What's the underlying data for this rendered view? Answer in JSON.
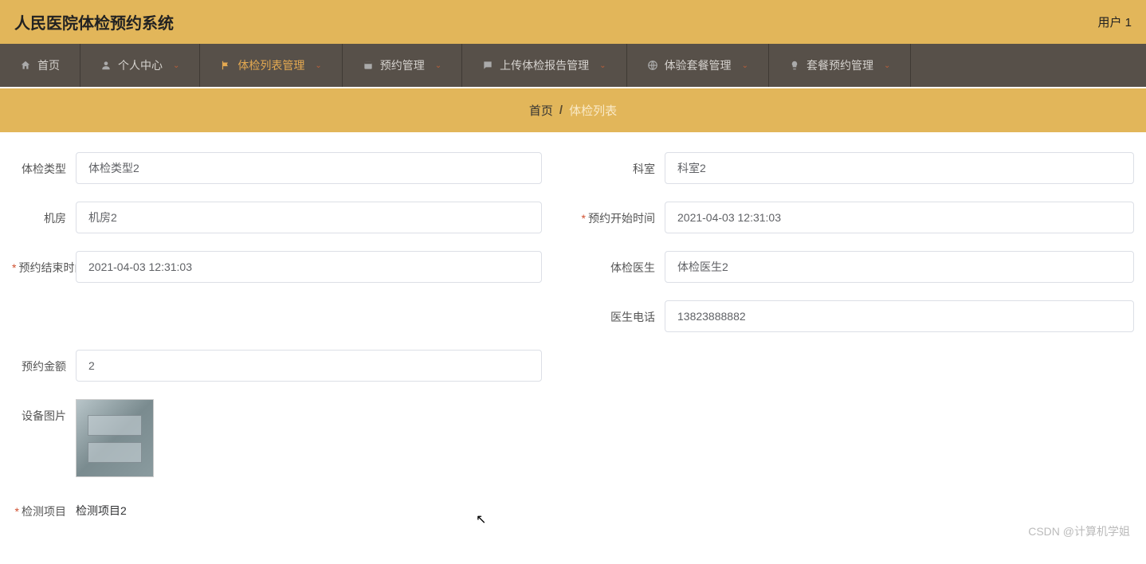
{
  "header": {
    "title": "人民医院体检预约系统",
    "user": "用户 1"
  },
  "nav": {
    "items": [
      {
        "label": "首页",
        "icon": "home",
        "dropdown": false
      },
      {
        "label": "个人中心",
        "icon": "user",
        "dropdown": true
      },
      {
        "label": "体检列表管理",
        "icon": "flag",
        "dropdown": true,
        "active": true
      },
      {
        "label": "预约管理",
        "icon": "calendar",
        "dropdown": true
      },
      {
        "label": "上传体检报告管理",
        "icon": "chat",
        "dropdown": true
      },
      {
        "label": "体验套餐管理",
        "icon": "globe",
        "dropdown": true
      },
      {
        "label": "套餐预约管理",
        "icon": "bulb",
        "dropdown": true
      }
    ]
  },
  "breadcrumb": {
    "home": "首页",
    "current": "体检列表"
  },
  "form": {
    "exam_type": {
      "label": "体检类型",
      "value": "体检类型2"
    },
    "department": {
      "label": "科室",
      "value": "科室2"
    },
    "room": {
      "label": "机房",
      "value": "机房2"
    },
    "start_time": {
      "label": "预约开始时间",
      "value": "2021-04-03 12:31:03",
      "required": true
    },
    "end_time": {
      "label": "预约结束时间",
      "value": "2021-04-03 12:31:03",
      "required": true
    },
    "doctor": {
      "label": "体检医生",
      "value": "体检医生2"
    },
    "doctor_phone": {
      "label": "医生电话",
      "value": "13823888882"
    },
    "amount": {
      "label": "预约金额",
      "value": "2"
    },
    "device_image": {
      "label": "设备图片"
    },
    "test_item": {
      "label": "检测项目",
      "value": "检测项目2",
      "required": true
    }
  },
  "watermark": "CSDN @计算机学姐"
}
